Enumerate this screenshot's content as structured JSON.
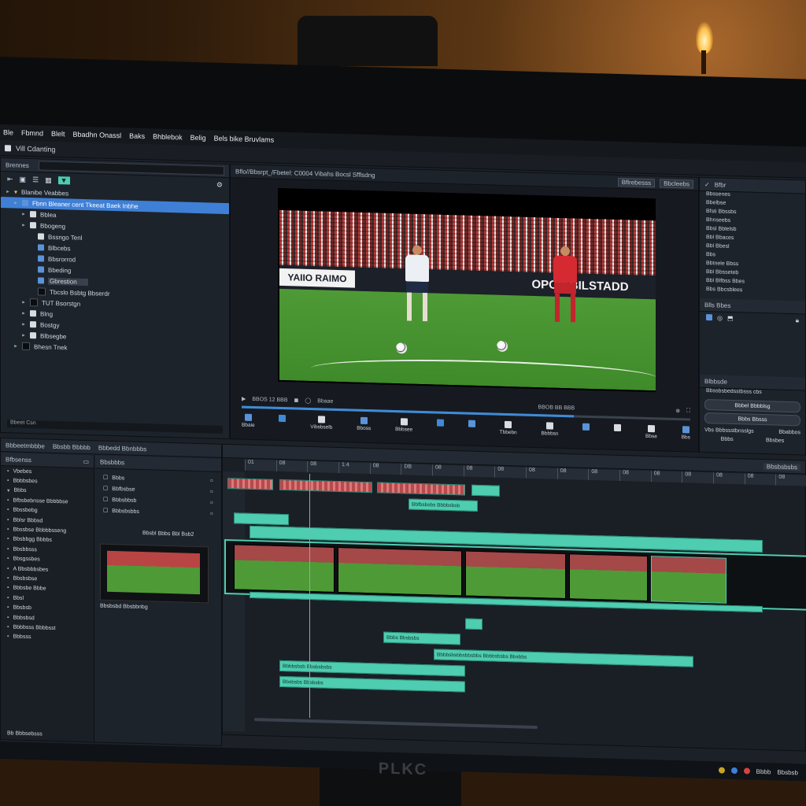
{
  "menubar": {
    "items": [
      "Ble",
      "Fbmnd",
      "Blelt",
      "Bbadhn Onassl",
      "Baks",
      "Bhblebok",
      "Belig",
      "Bels bike Bruvlams"
    ]
  },
  "titlebar": {
    "title": "Vill Cdanting"
  },
  "project": {
    "header": "Brennes",
    "items": [
      {
        "label": "Blanibe Veabbes",
        "level": 0,
        "type": "folder"
      },
      {
        "label": "Fbnn Bleaner cent Tkeeat Baek Inbhe",
        "level": 1,
        "type": "selected"
      },
      {
        "label": "Bblea",
        "level": 2,
        "type": "white"
      },
      {
        "label": "Bbogeng",
        "level": 2,
        "type": "white"
      },
      {
        "label": "Bssngo Tenl",
        "level": 3,
        "type": "white"
      },
      {
        "label": "Blbcebs",
        "level": 3,
        "type": "blue"
      },
      {
        "label": "Bbsrorrod",
        "level": 3,
        "type": "blue"
      },
      {
        "label": "Bbeding",
        "level": 3,
        "type": "blue"
      },
      {
        "label": "Gbrestion",
        "level": 3,
        "type": "highlight"
      },
      {
        "label": "Tbcslo Bsbtg Bbserdr",
        "level": 3,
        "type": "dark"
      },
      {
        "label": "TUT Bsorstgn",
        "level": 2,
        "type": "dark"
      },
      {
        "label": "Blng",
        "level": 2,
        "type": "white"
      },
      {
        "label": "Bostgy",
        "level": 2,
        "type": "white"
      },
      {
        "label": "Blbsegbe",
        "level": 2,
        "type": "white"
      },
      {
        "label": "Bhesn Tnek",
        "level": 1,
        "type": "dark"
      }
    ],
    "footer": "Bbeet Csn"
  },
  "viewer": {
    "header": "Bflo//Bbsrpt_/Fbetel: C0004 Vibahs Bocsl Sfflsdng",
    "header_buttons": [
      "Bflrebesss",
      "Bbcleebs"
    ],
    "board_left": "YAIIO RAIMO",
    "board_right": "OPOR BILSTADD",
    "timecode": "BBOS 12 BBB",
    "timecode_right": "BBOB BB BBB",
    "transport_label": "Bbaae",
    "progress": 0.74,
    "tools": [
      "Bbaie",
      "",
      "Vibsbselb",
      "Bboss",
      "Bbbsee",
      "",
      "",
      "Tbbebn",
      "Bbbbsn",
      "",
      "",
      "Bbse",
      "Bbs"
    ]
  },
  "inspector": {
    "header": "Bfbr",
    "rows": [
      "Bbssenes",
      "Bbelbse",
      "Bfsti Bbssbs",
      "Bhnseebs",
      "Bbsl Bblelsb",
      "Bbl Bbaces",
      "Bbl Bbesl",
      "Bbs",
      "Bbtnele Bbss",
      "Bbl Bbsseteb",
      "Bbl Blfbss Bbes",
      "Bbs Bbcsblees"
    ],
    "section2": "Blls Bbes",
    "section3": "Blbbsde",
    "section3_rows": [
      "Bbssbsbedsstbsss cbs"
    ],
    "buttons": [
      "Bbbel Bbbblsg",
      "Bbbs Bbsss"
    ],
    "footer_left": "Vbs Bbbssstbnsslgs",
    "footer_right": "Bbabbos",
    "footer_row2_left": "Bbbs",
    "footer_row2_right": "Bbsbes"
  },
  "browser": {
    "tabs": [
      "Bbbeetmbbbe",
      "Bbsbb Bbbbb",
      "Bbbedd Bbnbbbs"
    ],
    "effects_header": "Bfbsenss",
    "effects": [
      "Vbebes",
      "Bbbbsbes",
      "Bbbs",
      "Bfbsbebnsse Bbbbbse",
      "Bbssbebg",
      "Bblsr Bbbsd",
      "Bbssbse Bbbbbsseng",
      "Bbsbbgg Bbbbs",
      "Bbsbbsss",
      "Bbsgssbes",
      "A Bbsbbbsbes",
      "Bbsbsbse",
      "Bbbsbe Bbbe",
      "Bbsl",
      "Bbsbsb",
      "Bbbsbsd",
      "Bbbbsss Bbbbsst",
      "Bbbsss"
    ],
    "effects_footer": "Bb Bbbsebsss",
    "mid_header": "Bbsbbbs",
    "mid_items": [
      "Bbbs",
      "Bbfbsbse",
      "Bbbsbbsb",
      "Bbbsbsbbs"
    ],
    "preview_label": "Bbsbl Bbbs Bbl Bsb2",
    "preview_caption": "Bbsbsbd Bbsbbnbg"
  },
  "timeline": {
    "ruler": [
      "01",
      "08",
      "08",
      "1:4",
      "08",
      "DB",
      "08",
      "08",
      "08",
      "08",
      "08",
      "08",
      "08",
      "08",
      "08",
      "08",
      "08",
      "08"
    ],
    "clips_top": [
      "Bbfbsbsbs Bbbbsbsb",
      "Bbbs Bbsbsbs",
      "Bbbbsbsbbsbbsbbs Bbbbsbsbs Bbsbbs",
      "Bbbbsbsb Bbsbsbsbs",
      "Bbsbsbs Bbsbsbs"
    ],
    "header_right": "Bbsbsbsbs"
  },
  "taskbar": {
    "items": [
      "Bbbb",
      "Bbsbsb"
    ]
  },
  "monitor": {
    "brand": "PLKC"
  }
}
